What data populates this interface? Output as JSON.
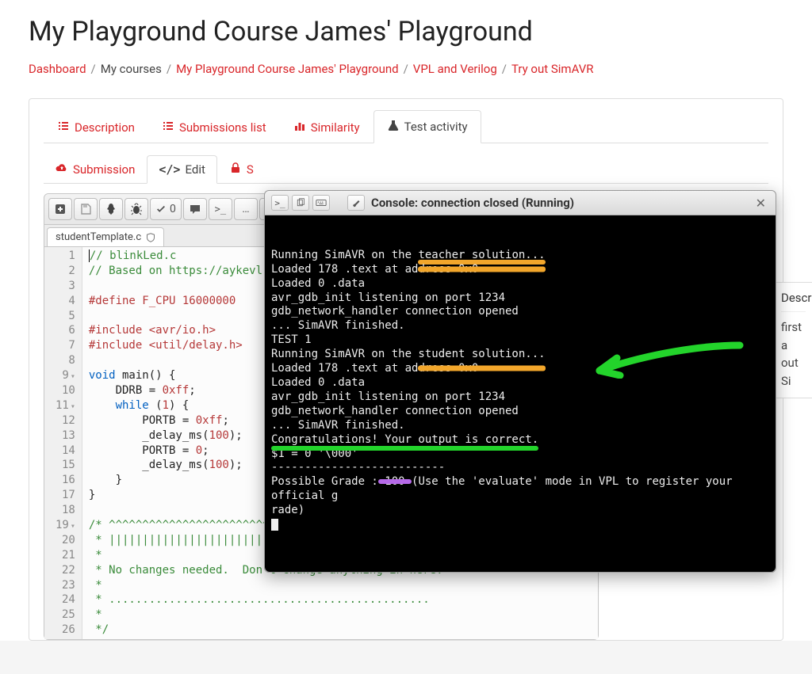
{
  "page_title": "My Playground Course James' Playground",
  "breadcrumb": [
    {
      "label": "Dashboard",
      "link": true
    },
    {
      "label": "My courses",
      "link": false
    },
    {
      "label": "My Playground Course James' Playground",
      "link": true
    },
    {
      "label": "VPL and Verilog",
      "link": true
    },
    {
      "label": "Try out SimAVR",
      "link": true
    }
  ],
  "tabs": [
    {
      "label": "Description",
      "icon": "list-icon"
    },
    {
      "label": "Submissions list",
      "icon": "list-ol-icon"
    },
    {
      "label": "Similarity",
      "icon": "chart-icon"
    },
    {
      "label": "Test activity",
      "icon": "flask-icon",
      "active": true
    }
  ],
  "subtabs": [
    {
      "label": "Submission",
      "icon": "cloud-upload-icon"
    },
    {
      "label": "Edit",
      "icon": "code-icon",
      "active": true
    },
    {
      "label": "S",
      "icon": "lock-icon",
      "truncated": true
    }
  ],
  "toolbar": {
    "new": "+",
    "save": "save",
    "run": "rocket",
    "debug": "bug",
    "evaluate_label": "0",
    "comments": "comment",
    "terminal": ">_",
    "more": "…",
    "expand": "expand"
  },
  "file_tab": {
    "name": "studentTemplate.c",
    "shield": true
  },
  "code_lines": [
    {
      "n": 1,
      "t": "// blinkLed.c",
      "cls": "c-green",
      "cursor": true
    },
    {
      "n": 2,
      "t": "// Based on https://aykevl.nl",
      "cls": "c-green"
    },
    {
      "n": 3,
      "t": ""
    },
    {
      "n": 4,
      "t": "#define F_CPU 16000000",
      "cls": "c-red"
    },
    {
      "n": 5,
      "t": ""
    },
    {
      "n": 6,
      "t": "#include <avr/io.h>",
      "cls": "c-red"
    },
    {
      "n": 7,
      "t": "#include <util/delay.h>",
      "cls": "c-red"
    },
    {
      "n": 8,
      "t": ""
    },
    {
      "n": 9,
      "fold": true,
      "segs": [
        {
          "t": "void",
          "c": "c-keyword"
        },
        {
          "t": " main() {"
        }
      ]
    },
    {
      "n": 10,
      "segs": [
        {
          "t": "    DDRB = "
        },
        {
          "t": "0xff",
          "c": "c-num"
        },
        {
          "t": ";"
        }
      ]
    },
    {
      "n": 11,
      "fold": true,
      "segs": [
        {
          "t": "    "
        },
        {
          "t": "while",
          "c": "c-keyword"
        },
        {
          "t": " ("
        },
        {
          "t": "1",
          "c": "c-num"
        },
        {
          "t": ") {"
        }
      ]
    },
    {
      "n": 12,
      "segs": [
        {
          "t": "        PORTB = "
        },
        {
          "t": "0xff",
          "c": "c-num"
        },
        {
          "t": ";"
        }
      ]
    },
    {
      "n": 13,
      "segs": [
        {
          "t": "        _delay_ms("
        },
        {
          "t": "100",
          "c": "c-num"
        },
        {
          "t": ");"
        }
      ]
    },
    {
      "n": 14,
      "segs": [
        {
          "t": "        PORTB = "
        },
        {
          "t": "0",
          "c": "c-num"
        },
        {
          "t": ";"
        }
      ]
    },
    {
      "n": 15,
      "segs": [
        {
          "t": "        _delay_ms("
        },
        {
          "t": "100",
          "c": "c-num"
        },
        {
          "t": ");"
        }
      ]
    },
    {
      "n": 16,
      "t": "    }"
    },
    {
      "n": 17,
      "t": "}"
    },
    {
      "n": 18,
      "t": ""
    },
    {
      "n": 19,
      "fold": true,
      "t": "/* ^^^^^^^^^^^^^^^^^^^^^^^^^^^^^^^^^^^^^^^^^^^^^^^^",
      "cls": "c-green"
    },
    {
      "n": 20,
      "t": " * ||||||||||||||||||||||||||||||||||||||||||||||||",
      "cls": "c-green"
    },
    {
      "n": 21,
      "t": " *",
      "cls": "c-green"
    },
    {
      "n": 22,
      "t": " * No changes needed.  Don't change anything in here.",
      "cls": "c-green"
    },
    {
      "n": 23,
      "t": " *",
      "cls": "c-green"
    },
    {
      "n": 24,
      "t": " * ................................................",
      "cls": "c-green"
    },
    {
      "n": 25,
      "t": " *",
      "cls": "c-green"
    },
    {
      "n": 26,
      "t": " */",
      "cls": "c-green"
    }
  ],
  "side_panel": {
    "header": "Descri",
    "body": "first a\nout Si"
  },
  "console": {
    "title": "Console: connection closed (Running)",
    "lines": [
      {
        "t": "Running SimAVR on the ",
        "tail": "teacher solution...",
        "tail_hl": "orange-under"
      },
      {
        "t": "Loaded 178 .text at ad",
        "tail": "dress 0x0          ",
        "tail_hl": "orange"
      },
      {
        "t": "Loaded 0 .data"
      },
      {
        "t": "avr_gdb_init listening on port 1234"
      },
      {
        "t": "gdb_network_handler connection opened"
      },
      {
        "t": "... SimAVR finished."
      },
      {
        "t": "TEST 1"
      },
      {
        "t": "Running SimAVR on the student solution..."
      },
      {
        "t": "Loaded 178 .text at ad",
        "tail": "dress 0x0          ",
        "tail_hl": "orange"
      },
      {
        "t": "Loaded 0 .data"
      },
      {
        "t": "avr_gdb_init listening on port 1234"
      },
      {
        "t": "gdb_network_handler connection opened"
      },
      {
        "t": "... SimAVR finished."
      },
      {
        "t": "Congratulations! Your output is correct.",
        "line_hl": "green-under"
      },
      {
        "t": ""
      },
      {
        "t": "$1 = 0 '\\000'"
      },
      {
        "t": "--------------------------"
      },
      {
        "t": "Possible Grade :",
        "tail": " 100 ",
        "tail_hl": "purple",
        "rest": "(Use the 'evaluate' mode in VPL to register your official g"
      },
      {
        "t": "rade)"
      },
      {
        "cursor": true
      }
    ]
  }
}
